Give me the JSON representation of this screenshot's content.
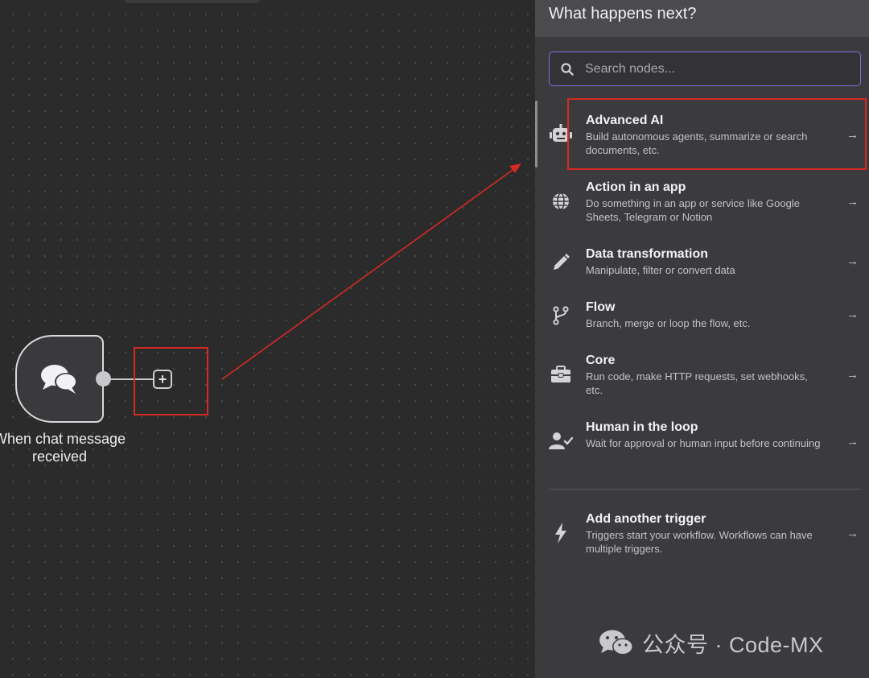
{
  "canvas": {
    "trigger_node": {
      "label": "When chat message received",
      "icon": "chat-bubbles-icon"
    },
    "add_button_icon": "plus-icon"
  },
  "panel": {
    "title": "What happens next?",
    "search": {
      "placeholder": "Search nodes...",
      "value": ""
    },
    "items": [
      {
        "title": "Advanced AI",
        "desc": "Build autonomous agents, summarize or search documents, etc.",
        "icon": "robot-icon"
      },
      {
        "title": "Action in an app",
        "desc": "Do something in an app or service like Google Sheets, Telegram or Notion",
        "icon": "globe-icon"
      },
      {
        "title": "Data transformation",
        "desc": "Manipulate, filter or convert data",
        "icon": "pencil-icon"
      },
      {
        "title": "Flow",
        "desc": "Branch, merge or loop the flow, etc.",
        "icon": "branch-icon"
      },
      {
        "title": "Core",
        "desc": "Run code, make HTTP requests, set webhooks, etc.",
        "icon": "toolbox-icon"
      },
      {
        "title": "Human in the loop",
        "desc": "Wait for approval or human input before continuing",
        "icon": "user-check-icon"
      }
    ],
    "trigger_item": {
      "title": "Add another trigger",
      "desc": "Triggers start your workflow. Workflows can have multiple triggers.",
      "icon": "bolt-icon"
    }
  },
  "watermark": {
    "text": "公众号 · Code-MX",
    "icon": "wechat-icon"
  },
  "colors": {
    "highlight": "#d42a22",
    "search_border": "#7b6fe3",
    "panel_bg": "#3b3b3d",
    "canvas_bg": "#2b2b2c"
  }
}
